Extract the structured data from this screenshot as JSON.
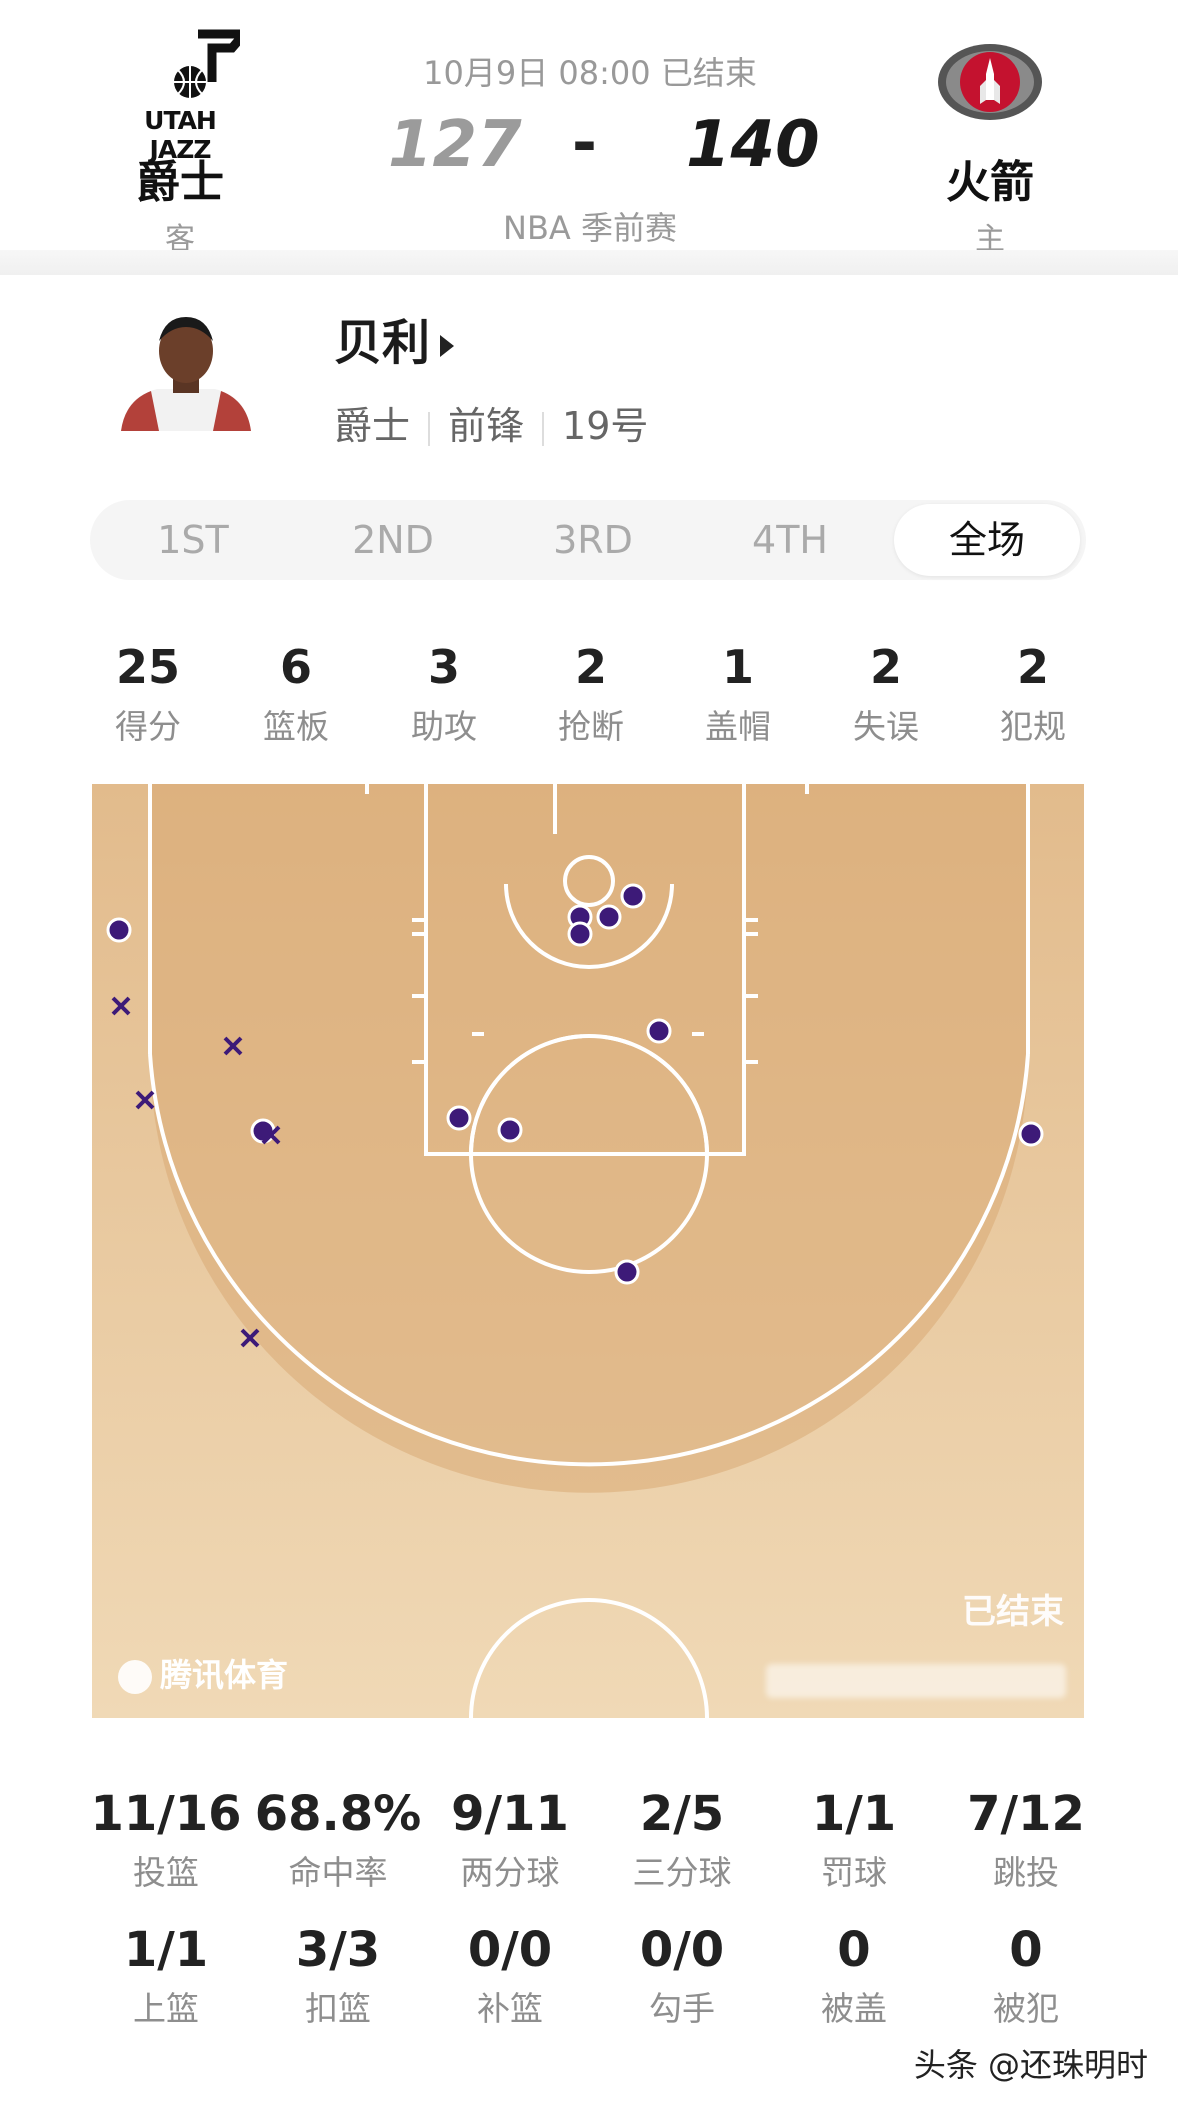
{
  "header": {
    "date_status": "10月9日 08:00 已结束",
    "competition": "NBA 季前赛",
    "away": {
      "logo_text": "UTAH JAZZ",
      "name": "爵士",
      "side": "客",
      "score": "127"
    },
    "home": {
      "logo_text": "HOUSTON ROCKETS",
      "name": "火箭",
      "side": "主",
      "score": "140"
    },
    "dash": "-"
  },
  "player": {
    "name": "贝利",
    "team": "爵士",
    "position": "前锋",
    "number": "19号"
  },
  "tabs": [
    {
      "label": "1ST",
      "active": false
    },
    {
      "label": "2ND",
      "active": false
    },
    {
      "label": "3RD",
      "active": false
    },
    {
      "label": "4TH",
      "active": false
    },
    {
      "label": "全场",
      "active": true
    }
  ],
  "summary_stats": [
    {
      "value": "25",
      "label": "得分"
    },
    {
      "value": "6",
      "label": "篮板"
    },
    {
      "value": "3",
      "label": "助攻"
    },
    {
      "value": "2",
      "label": "抢断"
    },
    {
      "value": "1",
      "label": "盖帽"
    },
    {
      "value": "2",
      "label": "失误"
    },
    {
      "value": "2",
      "label": "犯规"
    }
  ],
  "shot_chart": {
    "status": "已结束",
    "brand": "腾讯体育",
    "colors": {
      "made": "#3d1a78",
      "missed": "#3d1a78",
      "court": "#e6c092",
      "line": "#ffffff"
    },
    "made_count": 11,
    "missed_count": 5
  },
  "detail_stats": [
    {
      "value": "11/16",
      "label": "投篮"
    },
    {
      "value": "68.8%",
      "label": "命中率"
    },
    {
      "value": "9/11",
      "label": "两分球"
    },
    {
      "value": "2/5",
      "label": "三分球"
    },
    {
      "value": "1/1",
      "label": "罚球"
    },
    {
      "value": "7/12",
      "label": "跳投"
    },
    {
      "value": "1/1",
      "label": "上篮"
    },
    {
      "value": "3/3",
      "label": "扣篮"
    },
    {
      "value": "0/0",
      "label": "补篮"
    },
    {
      "value": "0/0",
      "label": "勾手"
    },
    {
      "value": "0",
      "label": "被盖"
    },
    {
      "value": "0",
      "label": "被犯"
    }
  ],
  "watermark": "头条 @还珠明时"
}
